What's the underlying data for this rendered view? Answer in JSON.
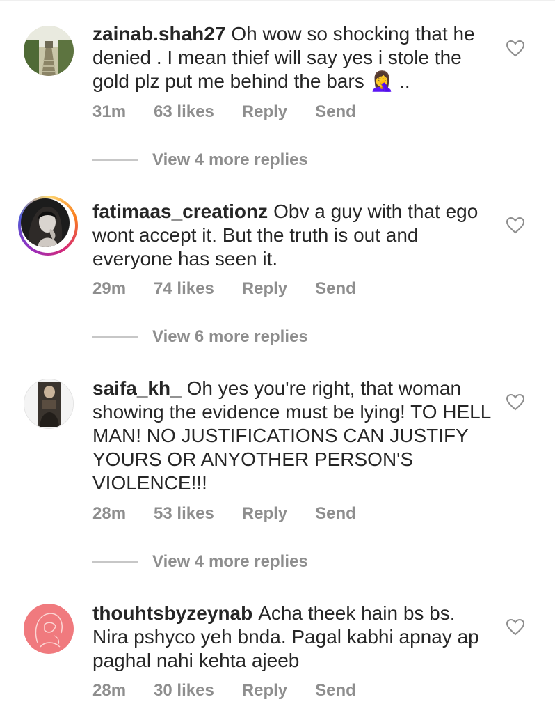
{
  "comments": [
    {
      "username": "zainab.shah27",
      "text": "Oh wow so shocking that he denied . I mean thief will say yes i stole the gold plz put me behind the bars 🤦‍♀️ ..",
      "time": "31m",
      "likes": "63 likes",
      "reply": "Reply",
      "send": "Send",
      "view_replies": "View 4 more replies"
    },
    {
      "username": "fatimaas_creationz",
      "text": "Obv a guy with that ego wont accept it. But the truth is out and everyone has seen it.",
      "time": "29m",
      "likes": "74 likes",
      "reply": "Reply",
      "send": "Send",
      "view_replies": "View 6 more replies"
    },
    {
      "username": "saifa_kh_",
      "text": "Oh yes you're right, that woman showing the evidence must be lying! TO HELL MAN! NO JUSTIFICATIONS CAN JUSTIFY YOURS OR ANYOTHER PERSON'S VIOLENCE!!!",
      "time": "28m",
      "likes": "53 likes",
      "reply": "Reply",
      "send": "Send",
      "view_replies": "View 4 more replies"
    },
    {
      "username": "thouhtsbyzeynab",
      "text": "Acha theek hain bs bs. Nira pshyco yeh bnda. Pagal kabhi apnay ap paghal nahi kehta ajeeb",
      "time": "28m",
      "likes": "30 likes",
      "reply": "Reply",
      "send": "Send"
    }
  ],
  "icons": {
    "like": "heart-outline-icon"
  },
  "colors": {
    "text": "#262626",
    "secondary": "#8e8e8e",
    "divider": "#c7c7c7"
  }
}
